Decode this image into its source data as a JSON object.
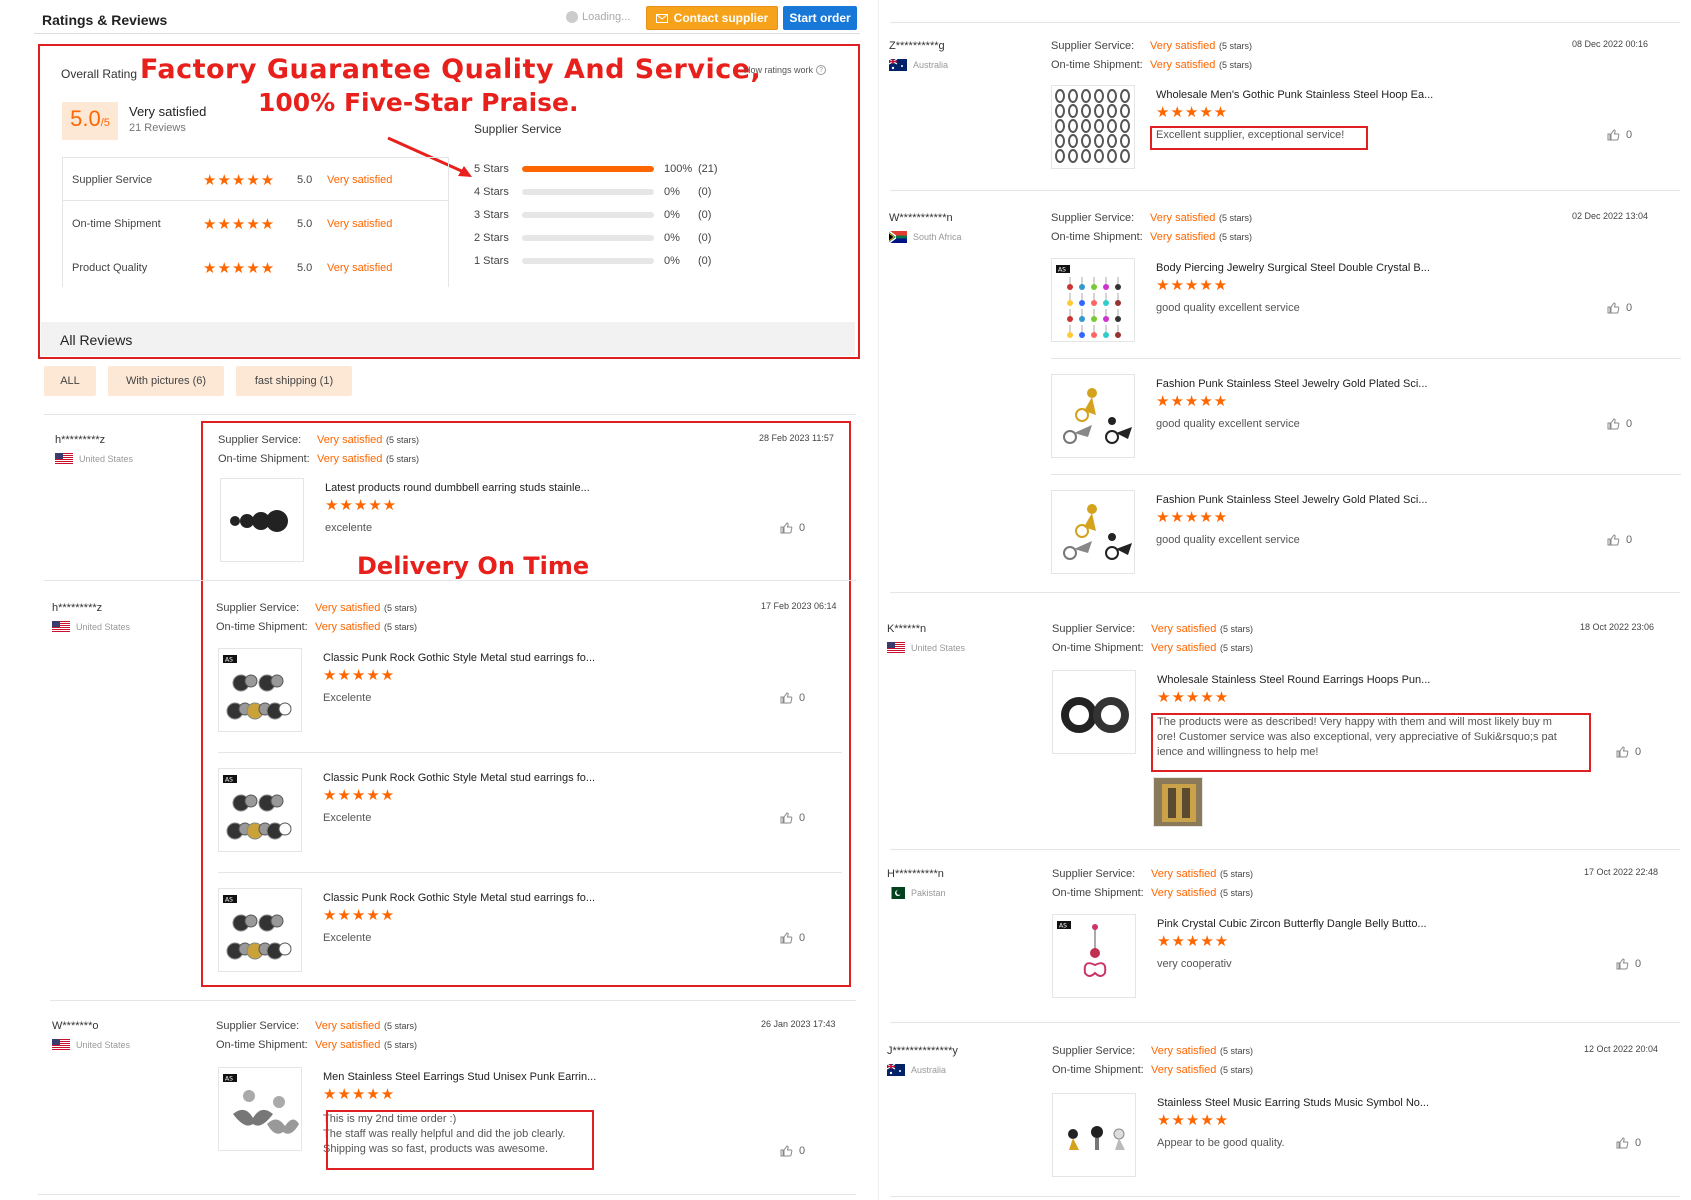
{
  "header": {
    "title": "Ratings & Reviews",
    "loading": "Loading...",
    "contact_label": "Contact supplier",
    "start_order_label": "Start order"
  },
  "overall": {
    "label": "Overall Rating",
    "score": "5.0",
    "score_suffix": "/5",
    "verdict": "Very satisfied",
    "reviews_count": "21 Reviews",
    "how_link": "How ratings work",
    "categories": [
      {
        "name": "Supplier Service",
        "value": "5.0",
        "verdict": "Very satisfied"
      },
      {
        "name": "On-time Shipment",
        "value": "5.0",
        "verdict": "Very satisfied"
      },
      {
        "name": "Product Quality",
        "value": "5.0",
        "verdict": "Very satisfied"
      }
    ],
    "distribution_title": "Supplier Service",
    "distribution": [
      {
        "label": "5 Stars",
        "fraction": 1.0,
        "pct": "100%",
        "count": "(21)"
      },
      {
        "label": "4 Stars",
        "fraction": 0.0,
        "pct": "0%",
        "count": "(0)"
      },
      {
        "label": "3 Stars",
        "fraction": 0.0,
        "pct": "0%",
        "count": "(0)"
      },
      {
        "label": "2 Stars",
        "fraction": 0.0,
        "pct": "0%",
        "count": "(0)"
      },
      {
        "label": "1 Stars",
        "fraction": 0.0,
        "pct": "0%",
        "count": "(0)"
      }
    ]
  },
  "promo": {
    "line1": "Factory Guarantee Quality And Service,",
    "line2": "100% Five-Star Praise.",
    "line3": "Delivery On Time"
  },
  "all_reviews_title": "All Reviews",
  "filters": [
    "ALL",
    "With pictures (6)",
    "fast shipping (1)"
  ],
  "labels": {
    "supplier_service": "Supplier Service:",
    "ontime_shipment": "On-time Shipment:",
    "very_satisfied": "Very satisfied",
    "five_stars": "(5 stars)",
    "stars_glyph": "★★★★★",
    "like_count": "0"
  },
  "left_reviews": [
    {
      "user": "h*********z",
      "country": "United States",
      "date": "28 Feb 2023 11:57",
      "items": [
        {
          "title": "Latest products round dumbbell earring studs stainle...",
          "text": "excelente"
        }
      ]
    },
    {
      "user": "h*********z",
      "country": "United States",
      "date": "17 Feb 2023 06:14",
      "items": [
        {
          "title": "Classic Punk Rock Gothic Style Metal stud earrings fo...",
          "text": "Excelente"
        },
        {
          "title": "Classic Punk Rock Gothic Style Metal stud earrings fo...",
          "text": "Excelente"
        },
        {
          "title": "Classic Punk Rock Gothic Style Metal stud earrings fo...",
          "text": "Excelente"
        }
      ]
    },
    {
      "user": "W*******o",
      "country": "United States",
      "date": "26 Jan 2023 17:43",
      "items": [
        {
          "title": "Men Stainless Steel Earrings Stud Unisex Punk Earrin...",
          "text_lines": [
            "This is my 2nd time order :)",
            "The staff was really helpful and did the job clearly.",
            "Shipping was so fast, products was awesome."
          ]
        }
      ]
    }
  ],
  "right_reviews": [
    {
      "user": "Z**********g",
      "country": "Australia",
      "date": "08 Dec 2022 00:16",
      "items": [
        {
          "title": "Wholesale Men's Gothic Punk Stainless Steel Hoop Ea...",
          "text": "Excellent supplier, exceptional service!"
        }
      ]
    },
    {
      "user": "W***********n",
      "country": "South Africa",
      "date": "02 Dec 2022 13:04",
      "items": [
        {
          "title": "Body Piercing Jewelry Surgical Steel Double Crystal B...",
          "text": "good quality excellent service"
        },
        {
          "title": "Fashion Punk Stainless Steel Jewelry Gold Plated Sci...",
          "text": "good quality excellent service"
        },
        {
          "title": "Fashion Punk Stainless Steel Jewelry Gold Plated Sci...",
          "text": "good quality excellent service"
        }
      ]
    },
    {
      "user": "K******n",
      "country": "United States",
      "date": "18 Oct 2022 23:06",
      "items": [
        {
          "title": "Wholesale Stainless Steel Round Earrings Hoops Pun...",
          "text_lines": [
            "The products were as described! Very happy with them and will most likely buy m",
            "ore! Customer service was also exceptional, very appreciative of Suki&rsquo;s pat",
            "ience and willingness to help me!"
          ]
        }
      ]
    },
    {
      "user": "H**********n",
      "country": "Pakistan",
      "date": "17 Oct 2022 22:48",
      "items": [
        {
          "title": "Pink Crystal Cubic Zircon Butterfly Dangle Belly Butto...",
          "text": "very cooperativ"
        }
      ]
    },
    {
      "user": "J**************y",
      "country": "Australia",
      "date": "12 Oct 2022 20:04",
      "items": [
        {
          "title": "Stainless Steel Music Earring Studs Music Symbol No...",
          "text": "Appear to be good quality."
        }
      ]
    }
  ],
  "colors": {
    "accent": "#ff6600",
    "highlight": "#e02020",
    "primary_blue": "#1778d8",
    "contact_orange": "#f7a21b"
  }
}
